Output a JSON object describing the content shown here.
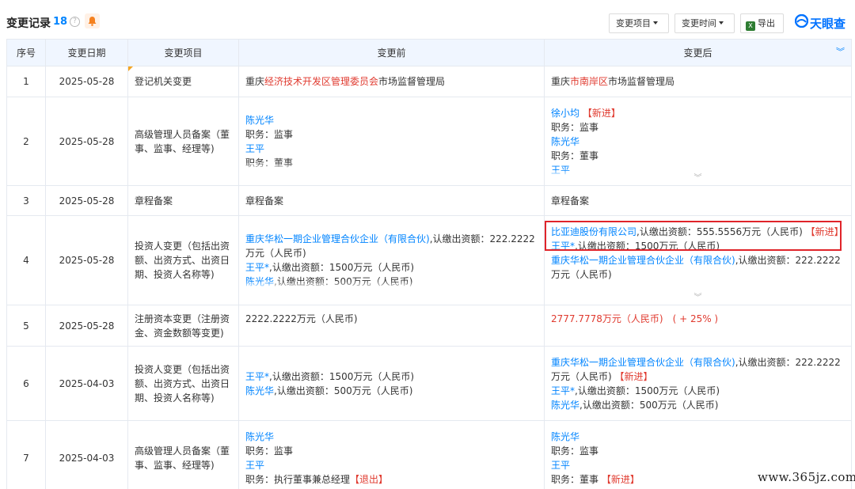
{
  "header": {
    "title": "变更记录",
    "count": "18",
    "help_glyph": "?",
    "buttons": {
      "change_item": "变更项目",
      "change_time": "变更时间",
      "export": "导出"
    },
    "logo_text": "天眼查",
    "excel_glyph": "X"
  },
  "columns": {
    "idx": "序号",
    "date": "变更日期",
    "item": "变更项目",
    "before": "变更前",
    "after": "变更后"
  },
  "rows": [
    {
      "idx": "1",
      "date": "2025-05-28",
      "item": "登记机关变更",
      "before": {
        "p1": "重庆",
        "p2": "经济技术开发区管理委员会",
        "p3": "市场监督管理局"
      },
      "after": {
        "p1": "重庆",
        "p2": "市南岸区",
        "p3": "市场监督管理局"
      }
    },
    {
      "idx": "2",
      "date": "2025-05-28",
      "item": "高级管理人员备案（董事、监事、经理等)",
      "before": [
        "陈光华",
        "职务：监事",
        "王平",
        "职务：董事"
      ],
      "after": {
        "n1": "徐小均",
        "tag1": "【新进】",
        "l2": "职务：监事",
        "n3": "陈光华",
        "l4": "职务：董事",
        "n5": "王平"
      }
    },
    {
      "idx": "3",
      "date": "2025-05-28",
      "item": "章程备案",
      "before": "章程备案",
      "after": "章程备案"
    },
    {
      "idx": "4",
      "date": "2025-05-28",
      "item": "投资人变更（包括出资额、出资方式、出资日期、投资人名称等)",
      "before": {
        "a_name": "重庆华松一期企业管理合伙企业（有限合伙)",
        "a_rest": ",认缴出资额：222.2222万元（人民币)",
        "b_name": "王平*",
        "b_rest": ",认缴出资额：1500万元（人民币)",
        "c_name": "陈光华",
        "c_rest": ",认缴出资额：500万元（人民币)"
      },
      "after": {
        "a_name": "比亚迪股份有限公司",
        "a_rest": ",认缴出资额：555.5556万元（人民币)",
        "a_tag": "【新进】",
        "b_name": "王平*",
        "b_rest": ",认缴出资额：1500万元（人民币)",
        "c_name": "重庆华松一期企业管理合伙企业（有限合伙)",
        "c_rest": ",认缴出资额：222.2222万元（人民币)"
      }
    },
    {
      "idx": "5",
      "date": "2025-05-28",
      "item": "注册资本变更（注册资金、资金数额等变更)",
      "before": "2222.2222万元（人民币)",
      "after": "2777.7778万元（人民币)　( + 25% )"
    },
    {
      "idx": "6",
      "date": "2025-04-03",
      "item": "投资人变更（包括出资额、出资方式、出资日期、投资人名称等)",
      "before": {
        "b_name": "王平*",
        "b_rest": ",认缴出资额：1500万元（人民币)",
        "c_name": "陈光华",
        "c_rest": ",认缴出资额：500万元（人民币)"
      },
      "after": {
        "a_name": "重庆华松一期企业管理合伙企业（有限合伙)",
        "a_rest": ",认缴出资额：222.2222万元（人民币)",
        "a_tag": "【新进】",
        "b_name": "王平*",
        "b_rest": ",认缴出资额：1500万元（人民币)",
        "c_name": "陈光华",
        "c_rest": ",认缴出资额：500万元（人民币)"
      }
    },
    {
      "idx": "7",
      "date": "2025-04-03",
      "item": "高级管理人员备案（董事、监事、经理等)",
      "before": {
        "n1": "陈光华",
        "l2": "职务：监事",
        "n3": "王平",
        "l4": "职务：执行董事兼总经理",
        "tag4": "【退出】"
      },
      "after": {
        "n1": "陈光华",
        "l2": "职务：监事",
        "n3": "王平",
        "l4": "职务：董事",
        "tag4": "【新进】"
      }
    }
  ],
  "watermark": "www.365jz.com",
  "colors": {
    "accent": "#0084ff",
    "red": "#e03a2f",
    "header_bg": "#f0f6ff",
    "highlight_border": "#e0242a"
  },
  "icons": [
    "help-icon",
    "bell-icon",
    "caret-down-icon",
    "excel-icon",
    "tianyancha-logo-icon",
    "expand-down-icon",
    "double-chevron-down-icon"
  ]
}
